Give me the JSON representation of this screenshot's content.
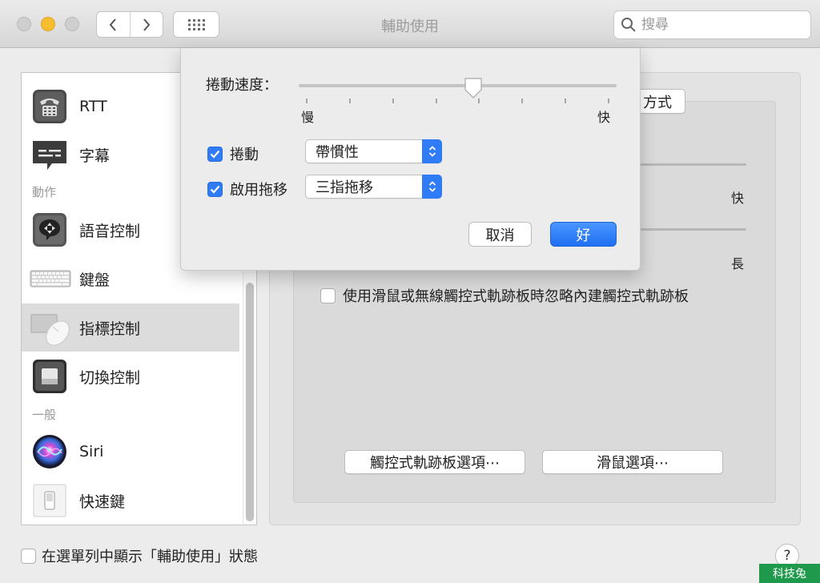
{
  "window": {
    "title": "輔助使用"
  },
  "search": {
    "placeholder": "搜尋"
  },
  "sidebar": {
    "items": [
      {
        "label": "RTT",
        "icon": "rtt-phone-icon"
      },
      {
        "label": "字幕",
        "icon": "captions-icon"
      },
      {
        "label": "語音控制",
        "icon": "voice-control-icon"
      },
      {
        "label": "鍵盤",
        "icon": "keyboard-icon"
      },
      {
        "label": "指標控制",
        "icon": "pointer-control-icon",
        "selected": true
      },
      {
        "label": "切換控制",
        "icon": "switch-control-icon"
      },
      {
        "label": "Siri",
        "icon": "siri-icon"
      },
      {
        "label": "快速鍵",
        "icon": "shortcut-icon"
      }
    ],
    "sections": {
      "motor": "動作",
      "general": "一般"
    }
  },
  "background": {
    "method_btn_partial": "方式",
    "fast_label": "快",
    "long_label": "長",
    "ignore_trackpad_label": "使用滑鼠或無線觸控式軌跡板時忽略內建觸控式軌跡板",
    "ignore_trackpad_checked": false,
    "trackpad_options_btn": "觸控式軌跡板選項⋯",
    "mouse_options_btn": "滑鼠選項⋯",
    "show_in_menubar_label": "在選單列中顯示「輔助使用」狀態",
    "show_in_menubar_checked": false,
    "help": "?"
  },
  "sheet": {
    "scroll_speed_label": "捲動速度：",
    "slow_label": "慢",
    "fast_label": "快",
    "scroll_speed_value": 0.55,
    "scroll_label": "捲動",
    "scroll_checked": true,
    "scroll_mode": "帶慣性",
    "drag_label": "啟用拖移",
    "drag_checked": true,
    "drag_mode": "三指拖移",
    "cancel_label": "取消",
    "ok_label": "好"
  },
  "watermark": "科技兔"
}
